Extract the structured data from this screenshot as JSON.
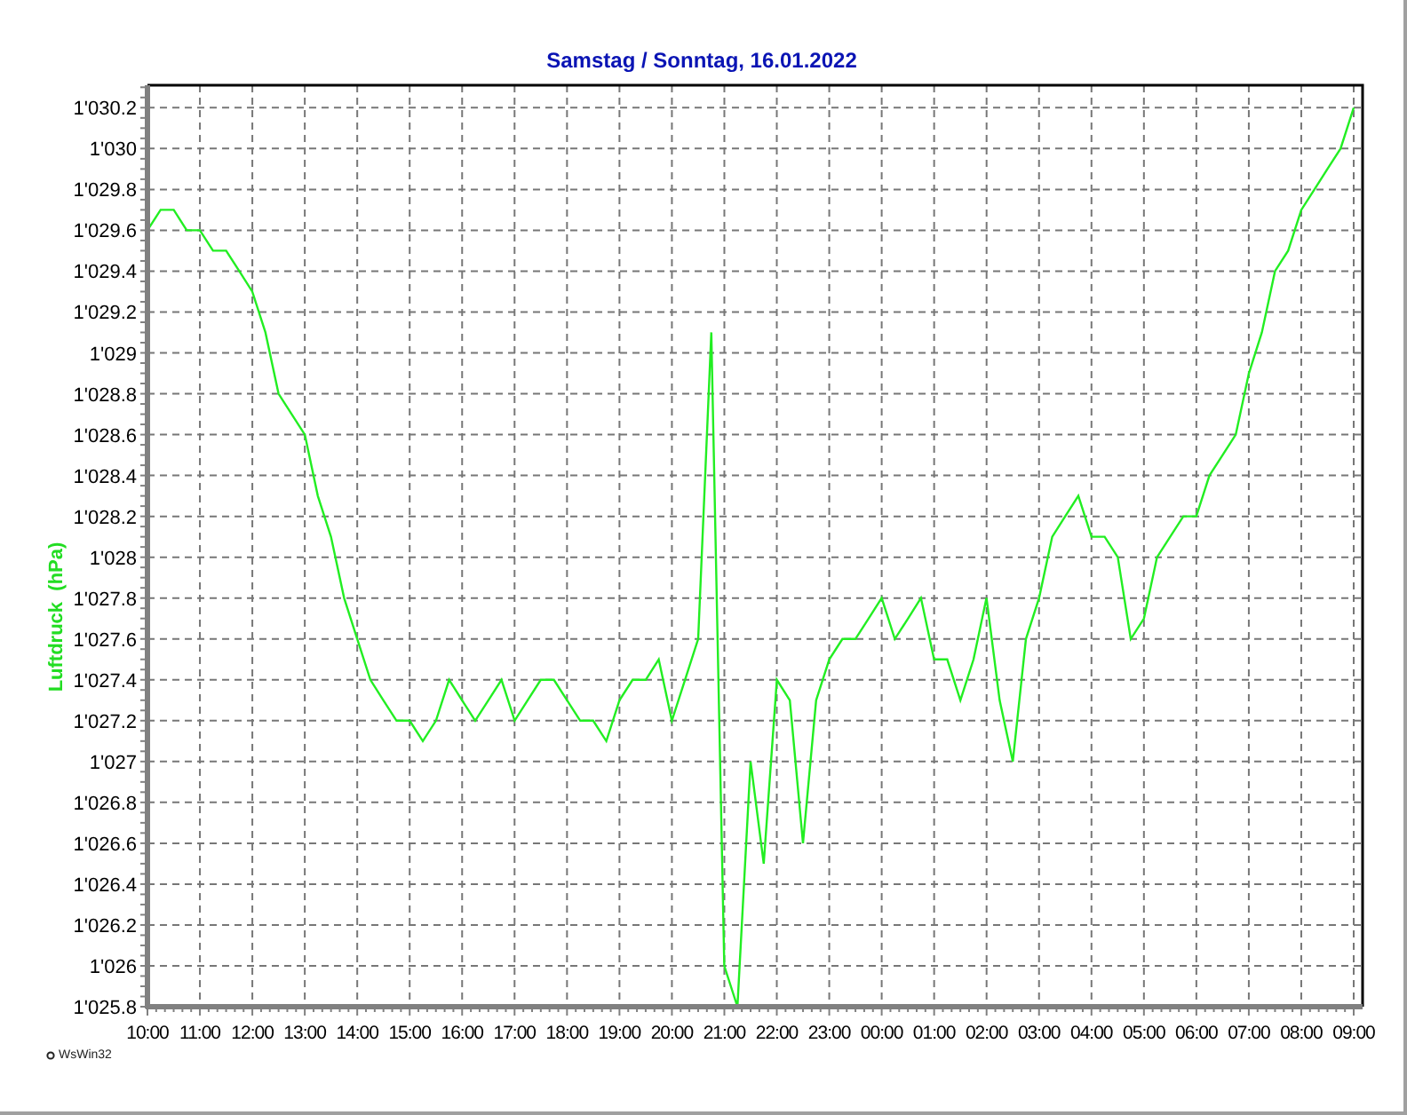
{
  "chart": {
    "chart_data": {
      "type": "line",
      "title": "Samstag / Sonntag, 16.01.2022",
      "ylabel": "Luftdruck  (hPa)",
      "ylim": [
        1025.8,
        1030.31
      ],
      "grid": true,
      "categories": [
        "10:00",
        null,
        null,
        null,
        "11:00",
        null,
        null,
        null,
        "12:00",
        null,
        null,
        null,
        "13:00",
        null,
        null,
        null,
        "14:00",
        null,
        null,
        null,
        "15:00",
        null,
        null,
        null,
        "16:00",
        null,
        null,
        null,
        "17:00",
        null,
        null,
        null,
        "18:00",
        null,
        null,
        null,
        "19:00",
        null,
        null,
        null,
        "20:00",
        null,
        null,
        null,
        "21:00",
        null,
        null,
        null,
        "22:00",
        null,
        null,
        null,
        "23:00",
        null,
        null,
        null,
        "00:00",
        null,
        null,
        null,
        "01:00",
        null,
        null,
        null,
        "02:00",
        null,
        null,
        null,
        "03:00",
        null,
        null,
        null,
        "04:00",
        null,
        null,
        null,
        "05:00",
        null,
        null,
        null,
        "06:00",
        null,
        null,
        null,
        "07:00",
        null,
        null,
        null,
        "08:00",
        null,
        null,
        null,
        "09:00"
      ],
      "yticks": [
        {
          "value": 1025.8,
          "label": "1'025.8"
        },
        {
          "value": 1026,
          "label": "1'026"
        },
        {
          "value": 1026.2,
          "label": "1'026.2"
        },
        {
          "value": 1026.4,
          "label": "1'026.4"
        },
        {
          "value": 1026.6,
          "label": "1'026.6"
        },
        {
          "value": 1026.8,
          "label": "1'026.8"
        },
        {
          "value": 1027,
          "label": "1'027"
        },
        {
          "value": 1027.2,
          "label": "1'027.2"
        },
        {
          "value": 1027.4,
          "label": "1'027.4"
        },
        {
          "value": 1027.6,
          "label": "1'027.6"
        },
        {
          "value": 1027.8,
          "label": "1'027.8"
        },
        {
          "value": 1028,
          "label": "1'028"
        },
        {
          "value": 1028.2,
          "label": "1'028.2"
        },
        {
          "value": 1028.4,
          "label": "1'028.4"
        },
        {
          "value": 1028.6,
          "label": "1'028.6"
        },
        {
          "value": 1028.8,
          "label": "1'028.8"
        },
        {
          "value": 1029,
          "label": "1'029"
        },
        {
          "value": 1029.2,
          "label": "1'029.2"
        },
        {
          "value": 1029.4,
          "label": "1'029.4"
        },
        {
          "value": 1029.6,
          "label": "1'029.6"
        },
        {
          "value": 1029.8,
          "label": "1'029.8"
        },
        {
          "value": 1030,
          "label": "1'030"
        },
        {
          "value": 1030.2,
          "label": "1'030.2"
        }
      ],
      "series": [
        {
          "color": "#22ee22",
          "values": [
            1029.6,
            1029.7,
            1029.7,
            1029.6,
            1029.6,
            1029.5,
            1029.5,
            1029.4,
            1029.3,
            1029.1,
            1028.8,
            1028.7,
            1028.6,
            1028.3,
            1028.1,
            1027.8,
            1027.6,
            1027.4,
            1027.3,
            1027.2,
            1027.2,
            1027.1,
            1027.2,
            1027.4,
            1027.3,
            1027.2,
            1027.3,
            1027.4,
            1027.2,
            1027.3,
            1027.4,
            1027.4,
            1027.3,
            1027.2,
            1027.2,
            1027.1,
            1027.3,
            1027.4,
            1027.4,
            1027.5,
            1027.2,
            1027.4,
            1027.6,
            1029.1,
            1026.0,
            1025.8,
            1027.0,
            1026.5,
            1027.4,
            1027.3,
            1026.6,
            1027.3,
            1027.5,
            1027.6,
            1027.6,
            1027.7,
            1027.8,
            1027.6,
            1027.7,
            1027.8,
            1027.5,
            1027.5,
            1027.3,
            1027.5,
            1027.8,
            1027.3,
            1027.0,
            1027.6,
            1027.8,
            1028.1,
            1028.2,
            1028.3,
            1028.1,
            1028.1,
            1028.0,
            1027.6,
            1027.7,
            1028.0,
            1028.1,
            1028.2,
            1028.2,
            1028.4,
            1028.5,
            1028.6,
            1028.9,
            1029.1,
            1029.4,
            1029.5,
            1029.7,
            1029.8,
            1029.9,
            1030.0,
            1030.2
          ]
        }
      ]
    }
  },
  "footer": {
    "text": "WsWin32"
  }
}
